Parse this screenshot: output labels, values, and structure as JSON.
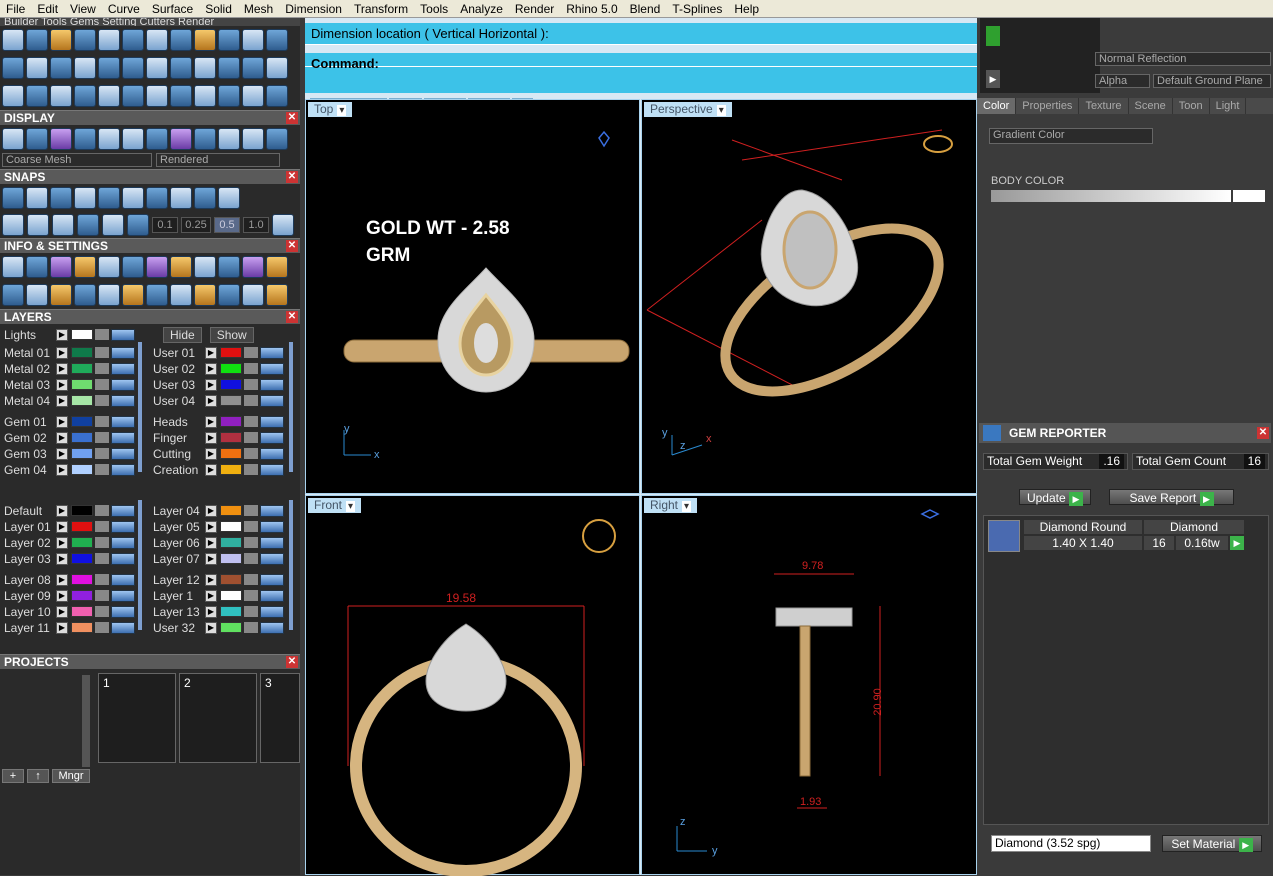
{
  "menu": [
    "File",
    "Edit",
    "View",
    "Curve",
    "Surface",
    "Solid",
    "Mesh",
    "Dimension",
    "Transform",
    "Tools",
    "Analyze",
    "Render",
    "Rhino 5.0",
    "Blend",
    "T-Splines",
    "Help"
  ],
  "top_tabs_text": "Builder  Tools  Gems  Setting  Cutters  Render",
  "panels": {
    "display": "DISPLAY",
    "snaps": "SNAPS",
    "info": "INFO & SETTINGS",
    "layers": "LAYERS",
    "projects": "PROJECTS"
  },
  "display": {
    "mesh": "Coarse Mesh",
    "mode": "Rendered"
  },
  "snaps": {
    "vals": [
      "0.1",
      "0.25",
      "0.5",
      "1.0"
    ]
  },
  "layers": {
    "lights": "Lights",
    "hide": "Hide",
    "show": "Show",
    "left": [
      {
        "name": "Metal 01",
        "color": "#0f7a4a"
      },
      {
        "name": "Metal 02",
        "color": "#1faa5a"
      },
      {
        "name": "Metal 03",
        "color": "#6fdc6f"
      },
      {
        "name": "Metal 04",
        "color": "#a6e6a6"
      },
      {
        "name": "Gem 01",
        "color": "#1040a0"
      },
      {
        "name": "Gem 02",
        "color": "#3a70d0"
      },
      {
        "name": "Gem 03",
        "color": "#70a0f0"
      },
      {
        "name": "Gem 04",
        "color": "#b0d0ff"
      },
      {
        "name": "Default",
        "color": "#000000"
      },
      {
        "name": "Layer 01",
        "color": "#e01010"
      },
      {
        "name": "Layer 02",
        "color": "#20b050"
      },
      {
        "name": "Layer 03",
        "color": "#1010e0"
      },
      {
        "name": "Layer 08",
        "color": "#e010e0"
      },
      {
        "name": "Layer 09",
        "color": "#9020e0"
      },
      {
        "name": "Layer 10",
        "color": "#f060b0"
      },
      {
        "name": "Layer 11",
        "color": "#f09060"
      }
    ],
    "right": [
      {
        "name": "User 01",
        "color": "#e01010"
      },
      {
        "name": "User 02",
        "color": "#10e010"
      },
      {
        "name": "User 03",
        "color": "#1010e0"
      },
      {
        "name": "User 04",
        "color": "#909090"
      },
      {
        "name": "Heads",
        "color": "#9020c0"
      },
      {
        "name": "Finger",
        "color": "#b03040"
      },
      {
        "name": "Cutting",
        "color": "#f07010"
      },
      {
        "name": "Creation",
        "color": "#f0b010"
      },
      {
        "name": "Layer 04",
        "color": "#f09010"
      },
      {
        "name": "Layer 05",
        "color": "#ffffff"
      },
      {
        "name": "Layer 06",
        "color": "#30b0a0"
      },
      {
        "name": "Layer 07",
        "color": "#c0c0f0"
      },
      {
        "name": "Layer 12",
        "color": "#a05030"
      },
      {
        "name": "Layer 1",
        "color": "#ffffff"
      },
      {
        "name": "Layer 13",
        "color": "#30c0c0"
      },
      {
        "name": "User 32",
        "color": "#60e060"
      }
    ]
  },
  "projects": {
    "slots": [
      "1",
      "2",
      "3"
    ],
    "mngr": "Mngr"
  },
  "command": {
    "line1": "Dimension location ( Vertical  Horizontal ):",
    "line2": "Command:"
  },
  "viewport_tabs": [
    "Perspective",
    "Top",
    "Front",
    "Right",
    "+"
  ],
  "viewports": {
    "top": "Top",
    "perspective": "Perspective",
    "front": "Front",
    "right": "Right"
  },
  "annotation": {
    "gold_wt": "GOLD WT - 2.58",
    "grm": "GRM"
  },
  "dims": {
    "front_width": "19.58",
    "right_top": "9.78",
    "right_height": "20.90",
    "right_bottom": "1.93"
  },
  "axes": {
    "x": "x",
    "y": "y",
    "z": "z"
  },
  "right_panel": {
    "reflection": "Normal Reflection",
    "alpha": "Alpha",
    "ground": "Default Ground Plane",
    "tabs": [
      "Color",
      "Properties",
      "Texture",
      "Scene",
      "Toon",
      "Light"
    ],
    "gradient": "Gradient Color",
    "body_color": "BODY COLOR"
  },
  "gem_reporter": {
    "title": "GEM REPORTER",
    "total_weight_label": "Total Gem Weight",
    "total_weight": ".16",
    "total_count_label": "Total Gem Count",
    "total_count": "16",
    "update": "Update",
    "save_report": "Save Report",
    "row": {
      "name": "Diamond Round",
      "size": "1.40 X 1.40",
      "type": "Diamond",
      "count": "16",
      "tw": "0.16tw"
    },
    "material": "Diamond     (3.52 spg)",
    "set_material": "Set Material"
  }
}
